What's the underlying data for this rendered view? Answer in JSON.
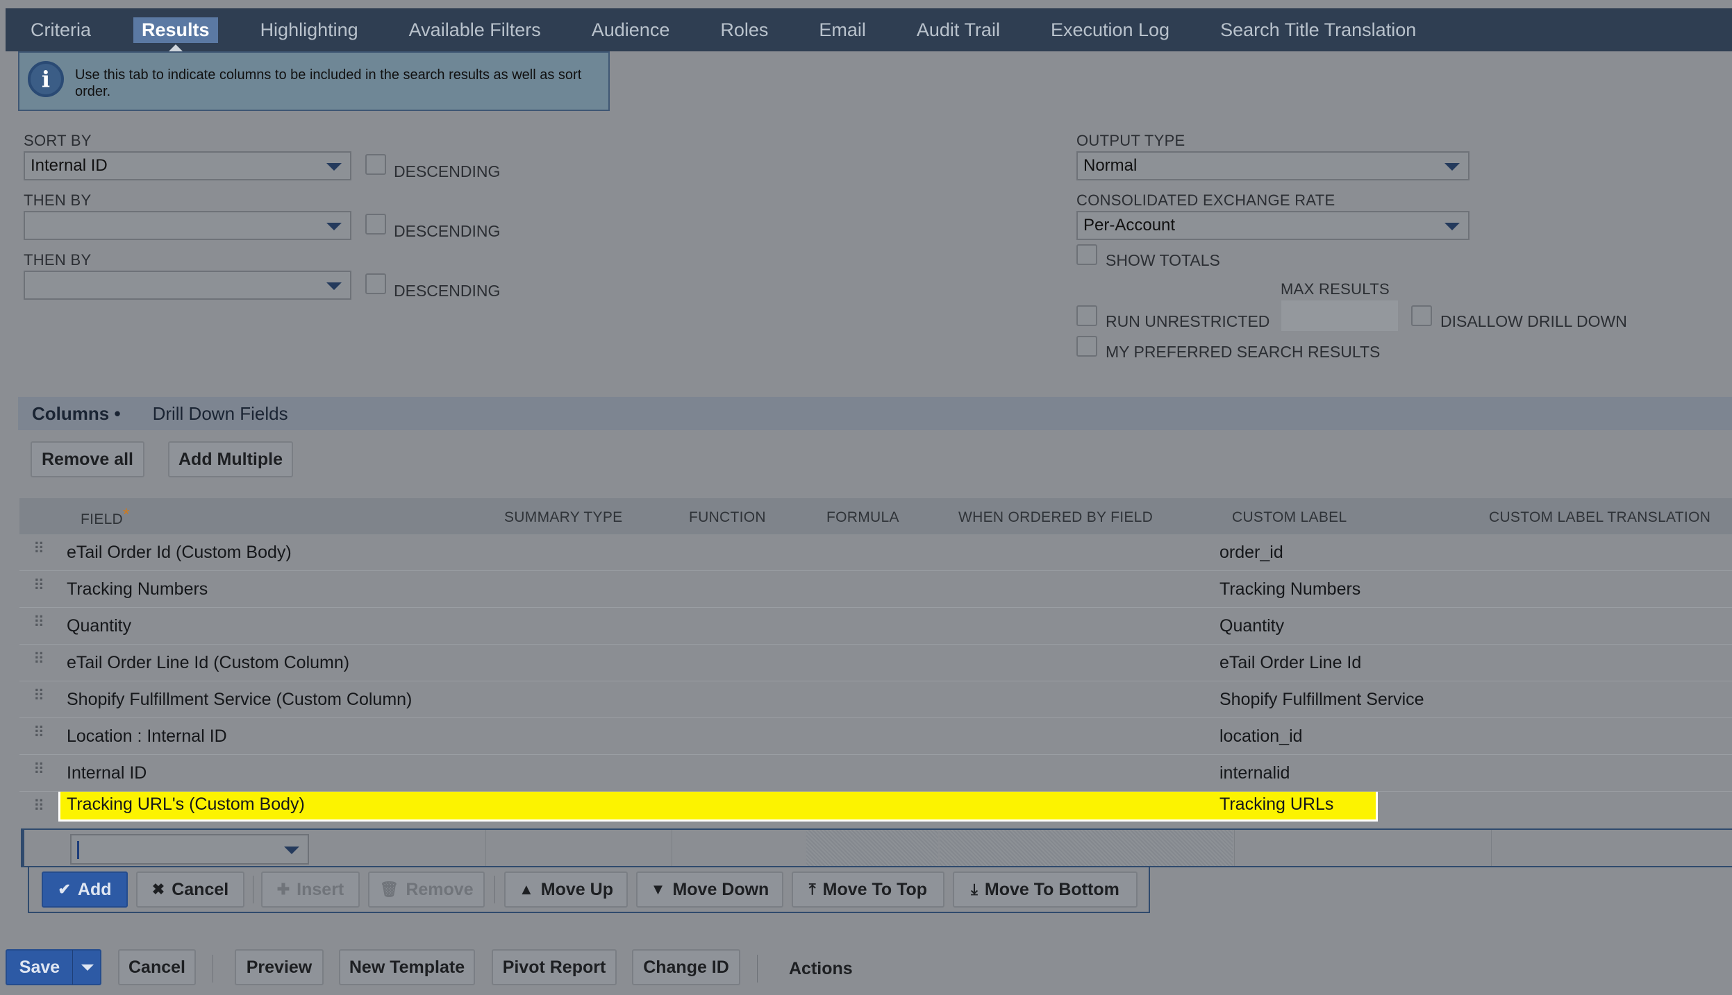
{
  "tabs": [
    "Criteria",
    "Results",
    "Highlighting",
    "Available Filters",
    "Audience",
    "Roles",
    "Email",
    "Audit Trail",
    "Execution Log",
    "Search Title Translation"
  ],
  "active_tab": "Results",
  "info": {
    "icon": "info-icon",
    "text": "Use this tab to indicate columns to be included in the search results as well as sort order."
  },
  "sort": {
    "sort_by_label": "SORT BY",
    "sort_by_value": "Internal ID",
    "then_by_label_1": "THEN BY",
    "then_by_value_1": "",
    "then_by_label_2": "THEN BY",
    "then_by_value_2": "",
    "descending_label": "DESCENDING"
  },
  "output": {
    "output_type_label": "OUTPUT TYPE",
    "output_type_value": "Normal",
    "exchange_rate_label": "CONSOLIDATED EXCHANGE RATE",
    "exchange_rate_value": "Per-Account",
    "show_totals": "SHOW TOTALS",
    "max_results": "MAX RESULTS",
    "run_unrestricted": "RUN UNRESTRICTED",
    "disallow_drill_down": "DISALLOW DRILL DOWN",
    "preferred_results": "MY PREFERRED SEARCH RESULTS"
  },
  "subtabs": {
    "columns": "Columns",
    "drill_down": "Drill Down Fields"
  },
  "column_buttons": {
    "remove_all": "Remove all",
    "add_multiple": "Add Multiple"
  },
  "table": {
    "headers": {
      "field": "FIELD",
      "summary_type": "SUMMARY TYPE",
      "function": "FUNCTION",
      "formula": "FORMULA",
      "when_ordered": "WHEN ORDERED BY FIELD",
      "custom_label": "CUSTOM LABEL",
      "custom_label_translation": "CUSTOM LABEL TRANSLATION"
    },
    "rows": [
      {
        "field": "eTail Order Id (Custom Body)",
        "label": "order_id"
      },
      {
        "field": "Tracking Numbers",
        "label": "Tracking Numbers"
      },
      {
        "field": "Quantity",
        "label": "Quantity"
      },
      {
        "field": "eTail Order Line Id (Custom Column)",
        "label": "eTail Order Line Id"
      },
      {
        "field": "Shopify Fulfillment Service (Custom Column)",
        "label": "Shopify Fulfillment Service"
      },
      {
        "field": "Location : Internal ID",
        "label": "location_id"
      },
      {
        "field": "Internal ID",
        "label": "internalid"
      },
      {
        "field": "Tracking URL's (Custom Body)",
        "label": "Tracking URLs"
      }
    ],
    "highlight_color": "#fcf300"
  },
  "row_actions": {
    "add": "Add",
    "cancel": "Cancel",
    "insert": "Insert",
    "remove": "Remove",
    "move_up": "Move Up",
    "move_down": "Move Down",
    "move_to_top": "Move To Top",
    "move_to_bottom": "Move To Bottom"
  },
  "footer": {
    "save": "Save",
    "cancel": "Cancel",
    "preview": "Preview",
    "new_template": "New Template",
    "pivot_report": "Pivot Report",
    "change_id": "Change ID",
    "actions": "Actions"
  },
  "colors": {
    "primary": "#2d5aa5",
    "tabbar": "#2f3e52",
    "active_tab": "#5b79a3"
  }
}
